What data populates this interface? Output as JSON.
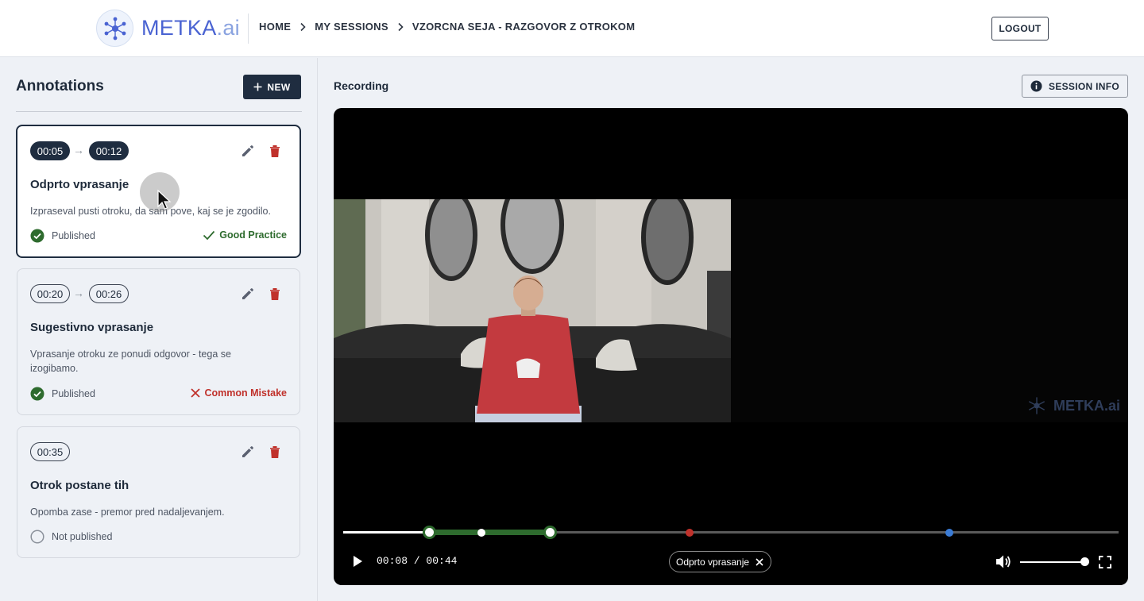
{
  "header": {
    "logo_text": "METKA",
    "logo_suffix": ".ai",
    "breadcrumbs": [
      "HOME",
      "MY SESSIONS",
      "VZORCNA SEJA - RAZGOVOR Z OTROKOM"
    ],
    "logout_label": "LOGOUT"
  },
  "sidebar": {
    "title": "Annotations",
    "new_label": "NEW",
    "cards": [
      {
        "start": "00:05",
        "end": "00:12",
        "title": "Odprto vprasanje",
        "description": "Izpraseval pusti otroku, da sam pove, kaj se je zgodilo.",
        "status": "Published",
        "tag": "Good Practice"
      },
      {
        "start": "00:20",
        "end": "00:26",
        "title": "Sugestivno vprasanje",
        "description": "Vprasanje otroku ze ponudi odgovor - tega se izogibamo.",
        "status": "Published",
        "tag": "Common Mistake"
      },
      {
        "start": "00:35",
        "title": "Otrok postane tih",
        "description": "Opomba zase - premor pred nadaljevanjem.",
        "status": "Not published"
      }
    ]
  },
  "main": {
    "title": "Recording",
    "session_info_label": "SESSION INFO",
    "player": {
      "current_time": "00:08",
      "duration": "00:44",
      "progress": 0.178,
      "volume": 1.0,
      "active_annotation": "Odprto vprasanje",
      "watermark": "METKA.ai"
    }
  },
  "colors": {
    "accent_dark": "#1f2d40",
    "good": "#2e6b2e",
    "mistake": "#c0312b",
    "marker_blue": "#3a7bd5"
  }
}
